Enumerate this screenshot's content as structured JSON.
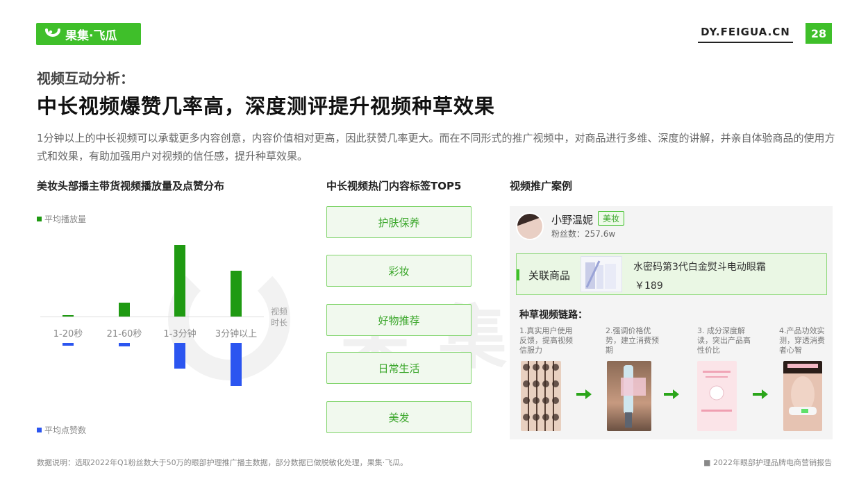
{
  "header": {
    "logo_text": "果集·飞瓜",
    "site": "DY.FEIGUA.CN",
    "page_number": "28"
  },
  "watermark": "果集·飞瓜",
  "subtitle": "视频互动分析：",
  "title": "中长视频爆赞几率高，深度测评提升视频种草效果",
  "description": "1分钟以上的中长视频可以承载更多内容创意，内容价值相对更高，因此获赞几率更大。而在不同形式的推广视频中，对商品进行多维、深度的讲解，并亲自体验商品的使用方式和效果，有助加强用户对视频的信任感，提升种草效果。",
  "left_section": {
    "title": "美妆头部播主带货视频播放量及点赞分布",
    "legend_top": "平均播放量",
    "legend_bottom": "平均点赞数",
    "axis_title": "视频时长"
  },
  "chart_data": {
    "type": "bar",
    "title": "美妆头部播主带货视频播放量及点赞分布",
    "xlabel": "视频时长",
    "categories": [
      "1-20秒",
      "21-60秒",
      "1-3分钟",
      "3分钟以上"
    ],
    "series": [
      {
        "name": "平均播放量",
        "values": [
          2,
          20,
          103,
          66
        ],
        "color": "#1f9a12",
        "direction": "up"
      },
      {
        "name": "平均点赞数",
        "values": [
          4,
          5,
          37,
          62
        ],
        "color": "#2b55f0",
        "direction": "down"
      }
    ],
    "value_axis": "unlabeled, relative",
    "legend": "top-left / bottom-left"
  },
  "middle_section": {
    "title": "中长视频热门内容标签TOP5",
    "tags": [
      "护肤保养",
      "彩妆",
      "好物推荐",
      "日常生活",
      "美发"
    ]
  },
  "case_section": {
    "title": "视频推广案例",
    "influencer_name": "小野温妮",
    "badge": "美妆",
    "fans": "粉丝数：257.6w",
    "product_label": "关联商品",
    "product_name": "水密码第3代白金熨斗电动眼霜",
    "product_price": "￥189",
    "chain_title": "种草视频链路：",
    "steps": [
      "1.真实用户使用反馈，提高视频信服力",
      "2.强调价格优势，建立消费预期",
      "3. 成分深度解读，突出产品高性价比",
      "4.产品功效实测，穿透消费者心智"
    ],
    "accent_color": "#3fbf2a"
  },
  "footer": {
    "note": "数据说明：选取2022年Q1粉丝数大于50万的眼部护理推广播主数据，部分数据已做脱敏化处理，果集·飞瓜。",
    "report": "■ 2022年眼部护理品牌电商营销报告"
  }
}
